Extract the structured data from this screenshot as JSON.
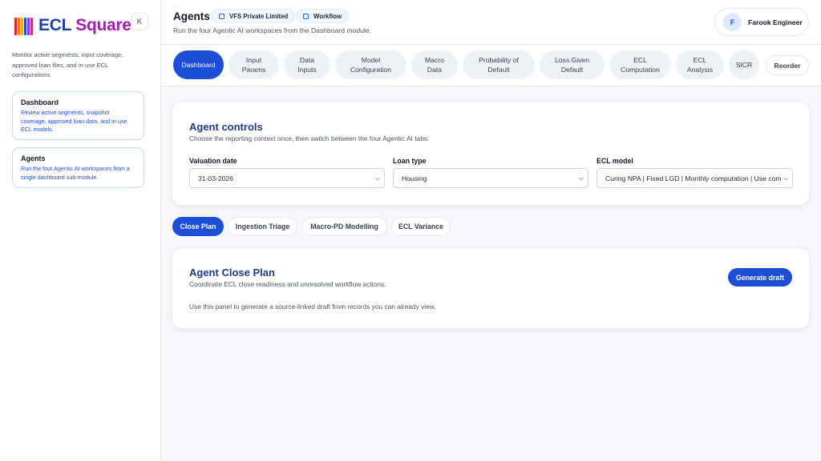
{
  "brand": {
    "name_part1": "ECL",
    "name_part2": "Square"
  },
  "sidebar": {
    "collapse_label": "K",
    "description": "Monitor active segments, input coverage, approved loan files, and in-use ECL configurations.",
    "items": [
      {
        "title": "Dashboard",
        "description": "Review active segments, snapshot coverage, approved loan data, and in-use ECL models."
      },
      {
        "title": "Agents",
        "description": "Run the four Agentic AI workspaces from a single dashboard sub-module."
      }
    ]
  },
  "header": {
    "title": "Agents",
    "chips": [
      "VFS Private Limited",
      "Workflow"
    ],
    "subtitle": "Run the four Agentic AI workspaces from the Dashboard module.",
    "user": {
      "initial": "F",
      "name": "Farook Engineer"
    }
  },
  "nav": {
    "tabs": [
      "Dashboard",
      "Input\nParams",
      "Data\nInputs",
      "Model\nConfiguration",
      "Macro\nData",
      "Probability of\nDefault",
      "Loss Given\nDefault",
      "ECL\nComputation",
      "ECL\nAnalysis",
      "SICR"
    ],
    "active_index": 0,
    "reorder_label": "Reorder"
  },
  "controls": {
    "title": "Agent controls",
    "subtitle": "Choose the reporting context once, then switch between the four Agentic AI tabs.",
    "fields": [
      {
        "label": "Valuation date",
        "value": "31-03-2026"
      },
      {
        "label": "Loan type",
        "value": "Housing"
      },
      {
        "label": "ECL model",
        "value": "Curing NPA | Fixed LGD | Monthly computation | Use com"
      }
    ]
  },
  "agent_tabs": {
    "items": [
      "Close Plan",
      "Ingestion Triage",
      "Macro-PD Modelling",
      "ECL Variance"
    ],
    "active_index": 0
  },
  "close_plan": {
    "title": "Agent Close Plan",
    "subtitle": "Coordinate ECL close readiness and unresolved workflow actions.",
    "body": "Use this panel to generate a source-linked draft from records you can already view.",
    "button_label": "Generate draft"
  },
  "colors": {
    "primary": "#1d4ed8",
    "brand_blue": "#1e40af",
    "brand_magenta": "#a21caf",
    "heading": "#1e3a8a"
  }
}
